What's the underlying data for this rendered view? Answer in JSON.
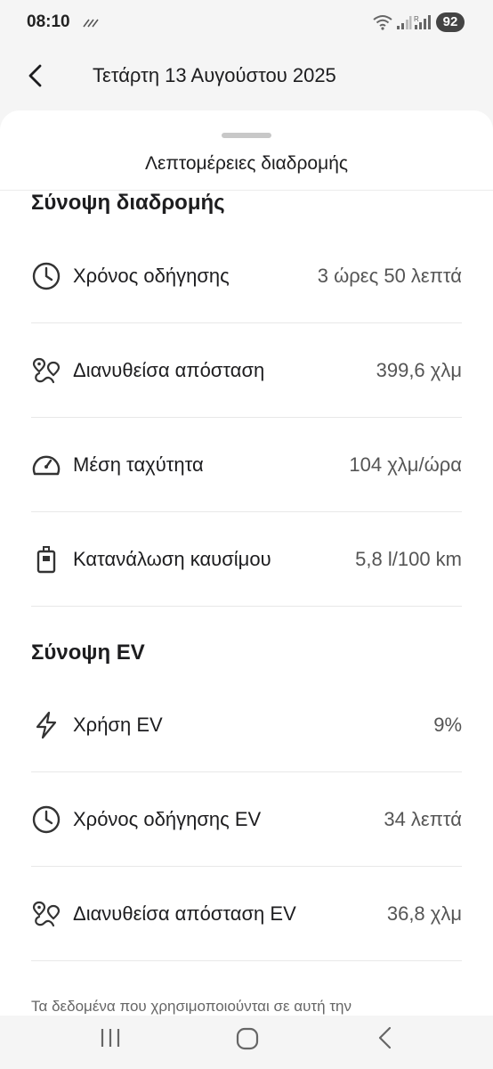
{
  "status_bar": {
    "time": "08:10",
    "battery": "92"
  },
  "header": {
    "title": "Τετάρτη 13 Αυγούστου 2025"
  },
  "sheet": {
    "title": "Λεπτομέρειες διαδρομής"
  },
  "trip_summary": {
    "title": "Σύνοψη διαδρομής",
    "rows": [
      {
        "icon": "clock-icon",
        "label": "Χρόνος οδήγησης",
        "value": "3 ώρες 50 λεπτά"
      },
      {
        "icon": "route-icon",
        "label": "Διανυθείσα απόσταση",
        "value": "399,6 χλμ"
      },
      {
        "icon": "speedometer-icon",
        "label": "Μέση ταχύτητα",
        "value": "104 χλμ/ώρα"
      },
      {
        "icon": "fuel-icon",
        "label": "Κατανάλωση καυσίμου",
        "value": "5,8 l/100 km"
      }
    ]
  },
  "ev_summary": {
    "title": "Σύνοψη EV",
    "rows": [
      {
        "icon": "lightning-icon",
        "label": "Χρήση EV",
        "value": "9%"
      },
      {
        "icon": "clock-icon",
        "label": "Χρόνος οδήγησης EV",
        "value": "34 λεπτά"
      },
      {
        "icon": "route-icon",
        "label": "Διανυθείσα απόσταση EV",
        "value": "36,8 χλμ"
      }
    ]
  },
  "footnote": "Τα δεδομένα που χρησιμοποιούνται σε αυτή την",
  "colors": {
    "background": "#f5f5f5",
    "sheet": "#ffffff",
    "text_primary": "#1d1d1f",
    "text_secondary": "#555555"
  }
}
